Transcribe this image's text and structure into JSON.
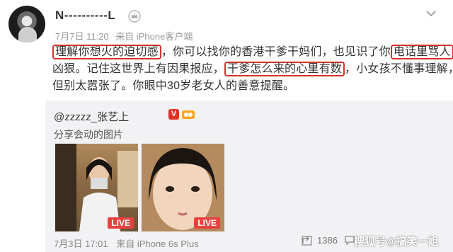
{
  "post": {
    "username": "N----------L",
    "date": "7月7日 11:20",
    "source": "来自 iPhone客户端",
    "lines": [
      {
        "pre": "",
        "hl": "理解你想火的迫切感",
        "post": "，你可以找你的香港干爹干妈们，也见识了你",
        "hl2": "电话里骂人",
        "post2": "的"
      },
      {
        "pre": "凶狠。记住这世界上有因果报应，",
        "hl": "干爹怎么来的心里有数",
        "post": "，小女孩不懂事理解，",
        "hl2": "",
        "post2": ""
      },
      {
        "pre": "但别太嚣张了。你眼中30岁老女人的善意提醒。",
        "hl": "",
        "post": "",
        "hl2": "",
        "post2": ""
      }
    ]
  },
  "repost": {
    "user": "@zzzzz_张艺上",
    "v_badge": "V",
    "share_text": "分享会动的图片",
    "live_label": "LIVE",
    "date": "7月3日 17:01",
    "source": "来自 iPhone 6s Plus",
    "shares": "1386",
    "comments": ""
  },
  "watermark": "搜狐号@搞笑一姐",
  "icons": [
    "avatar",
    "crown-icon",
    "chevron-down-icon",
    "v-badge-icon",
    "level-badge-icon",
    "share-icon",
    "comment-icon"
  ],
  "colors": {
    "highlight": "#d6332b",
    "live": "#e64340",
    "repost_bg": "#f2f2f5"
  }
}
